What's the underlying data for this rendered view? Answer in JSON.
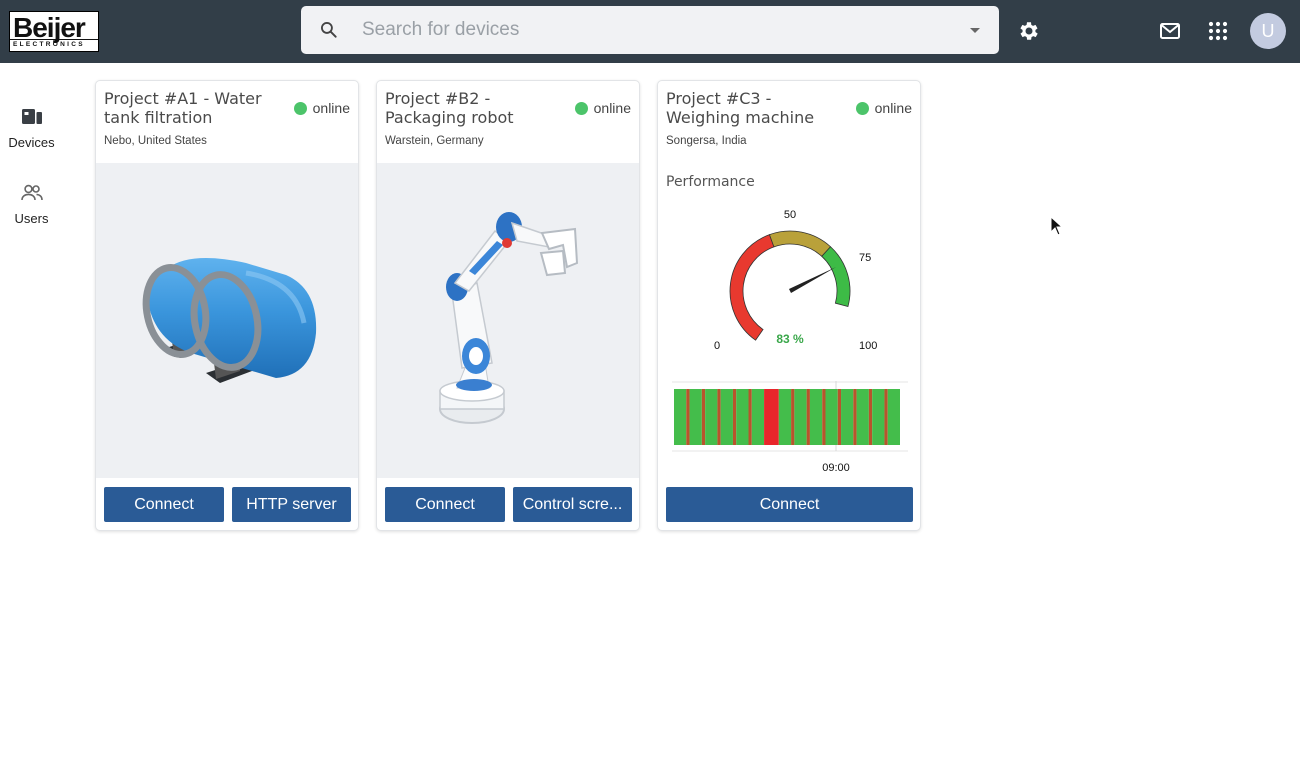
{
  "brand": {
    "logo_word": "Beijer",
    "logo_sub": "ELECTRONICS"
  },
  "search": {
    "placeholder": "Search for devices",
    "value": ""
  },
  "header_icons": [
    "search-icon",
    "chevron-down-icon",
    "gear-icon",
    "mail-icon",
    "apps-grid-icon"
  ],
  "user": {
    "initial": "U"
  },
  "sidebar": {
    "items": [
      {
        "label": "Devices",
        "icon": "devices-icon"
      },
      {
        "label": "Users",
        "icon": "users-icon"
      }
    ]
  },
  "devices": [
    {
      "title": "Project #A1 - Water tank filtration",
      "status": "online",
      "location": "Nebo, United States",
      "buttons": [
        "Connect",
        "HTTP server"
      ]
    },
    {
      "title": "Project #B2 - Packaging robot",
      "status": "online",
      "location": "Warstein, Germany",
      "buttons": [
        "Connect",
        "Control scre..."
      ]
    },
    {
      "title": "Project #C3 - Weighing machine",
      "status": "online",
      "location": "Songersa, India",
      "section": "Performance",
      "gauge": {
        "value": 83,
        "value_label": "83 %",
        "min_label": "0",
        "mid_label": "50",
        "high_label": "75",
        "max_label": "100",
        "zones": [
          {
            "from": 0,
            "to": 50,
            "color": "#e8392f"
          },
          {
            "from": 50,
            "to": 75,
            "color": "#b9a13a"
          },
          {
            "from": 75,
            "to": 100,
            "color": "#3dbb46"
          }
        ]
      },
      "timeline": {
        "time_label": "09:00",
        "segments": [
          "g",
          "r",
          "g",
          "r",
          "g",
          "r",
          "g",
          "r",
          "g",
          "r",
          "g",
          "R",
          "g",
          "r",
          "g",
          "r",
          "g",
          "r",
          "g",
          "r",
          "g",
          "r",
          "g",
          "r",
          "g",
          "r",
          "g"
        ]
      },
      "buttons": [
        "Connect"
      ]
    }
  ],
  "colors": {
    "topbar": "#323e48",
    "primary_button": "#2a5b96",
    "online": "#4cc46a"
  }
}
